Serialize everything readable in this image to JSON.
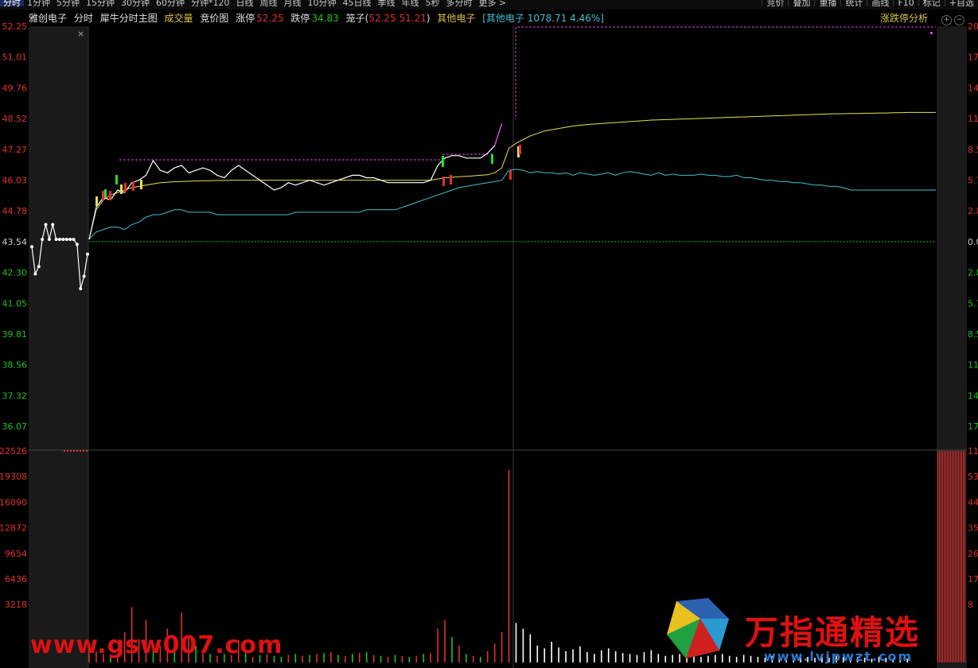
{
  "toolbar": {
    "tabs": [
      "分时",
      "1分钟",
      "5分钟",
      "15分钟",
      "30分钟",
      "60分钟",
      "分钟*120",
      "日线",
      "周线",
      "月线",
      "10分钟",
      "45日线",
      "季线",
      "年线",
      "5秒",
      "多分时",
      "更多 >"
    ],
    "right_buttons": [
      "竞价",
      "叠加",
      "重播",
      "统计",
      "画线",
      "F10",
      "标记",
      "+自选"
    ]
  },
  "info": {
    "stock_name": "雅创电子",
    "view": "分时",
    "indicator": "犀牛分时主图",
    "volume_label": "成交量",
    "auction_label": "竞价图",
    "limit_up_label": "涨停",
    "limit_up_value": "52.25",
    "limit_down_label": "跌停",
    "limit_down_value": "34.83",
    "cage_label": "笼子(",
    "cage_values": "52.25 51.21",
    "cage_close": ")",
    "sector_label": "其他电子",
    "sector_index": "[其他电子 1078.71 4.46%]",
    "analysis_button": "涨跌停分析",
    "close_x": "×"
  },
  "colors": {
    "up": "#e03030",
    "down": "#20c020",
    "price": "#ffffff",
    "avg": "#e8e050",
    "sector": "#40c0d0",
    "limit": "#e040e0",
    "base": "#20c020"
  },
  "chart_data": {
    "type": "line",
    "price_axis": {
      "ticks": [
        52.25,
        51.01,
        49.76,
        48.52,
        47.27,
        46.03,
        44.78,
        43.54,
        42.3,
        41.05,
        39.81,
        38.56,
        37.32,
        36.07
      ],
      "tick_labels": [
        "52.25",
        "51.01",
        "49.76",
        "48.52",
        "47.27",
        "46.03",
        "44.78",
        "43.54",
        "42.30",
        "41.05",
        "39.81",
        "38.56",
        "37.32",
        "36.07"
      ],
      "ylim": [
        34.83,
        52.25
      ],
      "pre_close": 43.54
    },
    "pct_axis_labels": [
      "20",
      "17",
      "14",
      "11",
      "8.5",
      "5.7",
      "2.8",
      "0.0",
      "2.8",
      "5.7",
      "8.5",
      "11",
      "14",
      "17"
    ],
    "volume_axis": {
      "tick_labels": [
        "22526",
        "19308",
        "16090",
        "12872",
        "9654",
        "6436",
        "3218"
      ],
      "right_labels": [
        "11",
        "53",
        "44",
        "35",
        "26",
        "17",
        "8"
      ],
      "ylim": [
        0,
        22526
      ]
    },
    "auction_price": [
      43.3,
      42.2,
      42.5,
      43.6,
      44.2,
      43.6,
      44.2,
      43.6,
      43.6,
      43.6,
      43.6,
      43.6,
      43.6,
      43.4,
      41.6,
      42.1,
      43.0
    ],
    "price": [
      43.6,
      44.9,
      45.3,
      45.2,
      45.6,
      45.5,
      45.9,
      46.0,
      46.2,
      46.8,
      46.4,
      46.3,
      46.5,
      46.6,
      46.3,
      46.4,
      46.5,
      46.4,
      46.2,
      46.1,
      46.4,
      46.6,
      46.4,
      46.2,
      46.0,
      45.8,
      45.6,
      45.7,
      45.9,
      45.8,
      45.9,
      46.0,
      45.9,
      45.8,
      45.9,
      46.0,
      46.1,
      46.2,
      46.2,
      46.1,
      46.1,
      46.0,
      45.9,
      45.9,
      45.9,
      45.9,
      45.9,
      45.9,
      46.0,
      46.6,
      46.9,
      47.0,
      47.0,
      46.9,
      46.9,
      46.9,
      47.1,
      47.4,
      48.3,
      52.25,
      52.25,
      52.25,
      52.25,
      52.25,
      52.25,
      52.25,
      52.25,
      52.25,
      52.25,
      52.25,
      52.25,
      52.25,
      52.25,
      52.25,
      52.25,
      52.25,
      52.25,
      52.25,
      52.25,
      52.25,
      52.25,
      52.25,
      52.25,
      52.25,
      52.25,
      52.25,
      52.25,
      52.25,
      52.25,
      52.25,
      52.25,
      52.25,
      52.25,
      52.25,
      52.25,
      52.25,
      52.25,
      52.25,
      52.25,
      52.25,
      52.25,
      52.25,
      52.25,
      52.25,
      52.25,
      52.25,
      52.25,
      52.25,
      52.25,
      52.25,
      52.25,
      52.25,
      52.25,
      52.25,
      52.25,
      52.25,
      52.25,
      52.25,
      52.25,
      52.25
    ],
    "avg_price": [
      43.6,
      44.8,
      45.2,
      45.4,
      45.5,
      45.6,
      45.7,
      45.75,
      45.8,
      45.85,
      45.9,
      45.92,
      45.94,
      45.95,
      45.96,
      45.97,
      45.98,
      45.98,
      45.99,
      45.99,
      46.0,
      46.0,
      46.0,
      46.0,
      46.0,
      46.0,
      46.0,
      46.0,
      46.0,
      46.0,
      46.0,
      46.0,
      46.0,
      46.0,
      46.0,
      46.0,
      46.0,
      46.0,
      46.0,
      46.0,
      46.0,
      46.0,
      46.0,
      46.0,
      46.0,
      46.0,
      46.0,
      46.0,
      46.0,
      46.05,
      46.1,
      46.12,
      46.14,
      46.16,
      46.18,
      46.2,
      46.22,
      46.3,
      46.5,
      47.3,
      47.5,
      47.65,
      47.8,
      47.9,
      48.0,
      48.05,
      48.1,
      48.15,
      48.2,
      48.23,
      48.26,
      48.28,
      48.3,
      48.32,
      48.34,
      48.36,
      48.38,
      48.4,
      48.42,
      48.44,
      48.45,
      48.46,
      48.47,
      48.48,
      48.49,
      48.5,
      48.51,
      48.52,
      48.53,
      48.54,
      48.55,
      48.56,
      48.57,
      48.58,
      48.59,
      48.6,
      48.61,
      48.62,
      48.63,
      48.64,
      48.65,
      48.66,
      48.67,
      48.68,
      48.69,
      48.7,
      48.7,
      48.71,
      48.71,
      48.72,
      48.72,
      48.73,
      48.73,
      48.74,
      48.74,
      48.75,
      48.75,
      48.75,
      48.75,
      48.75
    ],
    "sector": [
      43.6,
      43.9,
      44.0,
      44.1,
      44.1,
      44.0,
      44.2,
      44.3,
      44.5,
      44.6,
      44.6,
      44.7,
      44.8,
      44.8,
      44.7,
      44.7,
      44.7,
      44.7,
      44.6,
      44.6,
      44.6,
      44.6,
      44.6,
      44.6,
      44.6,
      44.6,
      44.6,
      44.6,
      44.6,
      44.7,
      44.7,
      44.7,
      44.7,
      44.7,
      44.7,
      44.7,
      44.7,
      44.7,
      44.7,
      44.8,
      44.8,
      44.8,
      44.8,
      44.8,
      44.9,
      45.0,
      45.1,
      45.2,
      45.3,
      45.4,
      45.5,
      45.6,
      45.7,
      45.75,
      45.8,
      45.85,
      45.9,
      45.95,
      46.0,
      46.4,
      46.45,
      46.4,
      46.3,
      46.35,
      46.3,
      46.3,
      46.25,
      46.3,
      46.2,
      46.3,
      46.25,
      46.2,
      46.25,
      46.3,
      46.2,
      46.3,
      46.35,
      46.3,
      46.25,
      46.2,
      46.3,
      46.2,
      46.25,
      46.2,
      46.2,
      46.2,
      46.25,
      46.2,
      46.2,
      46.15,
      46.15,
      46.2,
      46.1,
      46.1,
      46.05,
      46.0,
      46.0,
      45.95,
      45.95,
      45.9,
      45.9,
      45.85,
      45.8,
      45.8,
      45.75,
      45.75,
      45.7,
      45.6,
      45.6,
      45.6,
      45.6,
      45.6,
      45.6,
      45.6,
      45.6,
      45.6,
      45.6,
      45.6,
      45.6,
      45.6
    ],
    "volume": [
      2100,
      1200,
      900,
      800,
      700,
      3218,
      5900,
      2500,
      4500,
      1500,
      1800,
      3600,
      1200,
      5300,
      2600,
      1800,
      1000,
      900,
      700,
      900,
      800,
      2400,
      1000,
      600,
      800,
      900,
      700,
      600,
      800,
      900,
      700,
      800,
      900,
      1000,
      1100,
      800,
      700,
      900,
      1000,
      1100,
      800,
      700,
      600,
      800,
      700,
      600,
      700,
      900,
      1000,
      3600,
      4500,
      2700,
      1800,
      900,
      700,
      600,
      1200,
      2000,
      3218,
      20500,
      4200,
      3600,
      3000,
      1800,
      1500,
      2200,
      1600,
      1200,
      1400,
      1700,
      1100,
      900,
      1300,
      1500,
      1200,
      1000,
      900,
      800,
      1100,
      1300,
      900,
      700,
      800,
      900,
      1000,
      800,
      600,
      700,
      800,
      900,
      700,
      600,
      800,
      700,
      600,
      500,
      700,
      600,
      500,
      700,
      800,
      600,
      500,
      600,
      500,
      700,
      600,
      500,
      600,
      500,
      400,
      600,
      500,
      400,
      500,
      400
    ],
    "volume_colors": [
      "r",
      "r",
      "r",
      "g",
      "r",
      "r",
      "r",
      "r",
      "r",
      "g",
      "r",
      "r",
      "g",
      "r",
      "r",
      "g",
      "r",
      "g",
      "r",
      "g",
      "r",
      "r",
      "g",
      "r",
      "g",
      "r",
      "g",
      "g",
      "r",
      "g",
      "r",
      "g",
      "r",
      "g",
      "r",
      "g",
      "r",
      "g",
      "r",
      "g",
      "r",
      "g",
      "r",
      "g",
      "r",
      "g",
      "r",
      "g",
      "r",
      "r",
      "r",
      "g",
      "r",
      "g",
      "r",
      "g",
      "r",
      "r",
      "r",
      "r",
      "w",
      "w",
      "w",
      "w",
      "w",
      "w",
      "w",
      "w",
      "w",
      "w",
      "w",
      "w",
      "w",
      "w",
      "w",
      "w",
      "w",
      "w",
      "w",
      "w",
      "w",
      "w",
      "w",
      "w",
      "w",
      "w",
      "w",
      "w",
      "w",
      "w",
      "w",
      "w",
      "w",
      "w",
      "w",
      "w",
      "w",
      "w",
      "w",
      "w",
      "w",
      "w",
      "w",
      "w",
      "w",
      "w",
      "w",
      "w",
      "w",
      "w",
      "w",
      "w",
      "w",
      "w",
      "w",
      "w",
      "w",
      "w",
      "w",
      "w"
    ]
  },
  "watermarks": {
    "left": "www.gsw007.com",
    "right": "万指通精选",
    "url": "www.lvjpwzt.com"
  }
}
